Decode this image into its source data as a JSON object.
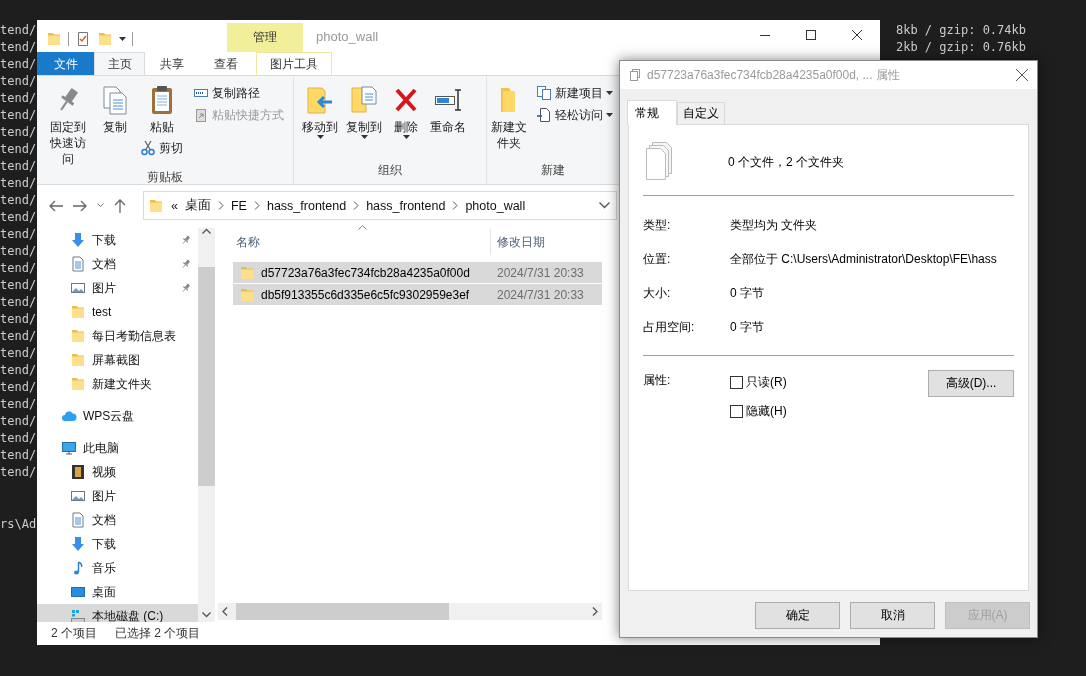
{
  "terminal": {
    "left_lines": [
      "tend/",
      "tend/",
      "tend/",
      "tend/",
      "tend/",
      "tend/",
      "tend/",
      "tend/",
      "tend/",
      "tend/",
      "tend/",
      "tend/",
      "tend/",
      "tend/",
      "tend/",
      "tend/",
      "tend/",
      "tend/",
      "tend/",
      "tend/",
      "tend/",
      "tend/",
      "tend/",
      "tend/",
      "tend/",
      "tend/",
      "tend/"
    ],
    "prompt_fragment": "rs\\Ad",
    "right_lines": [
      "8kb / gzip: 0.74kb",
      "2kb / gzip: 0.76kb"
    ]
  },
  "explorer": {
    "title": "photo_wall",
    "context_group": "管理",
    "ribbon_tabs": [
      {
        "label": "文件",
        "kind": "file",
        "selected": false
      },
      {
        "label": "主页",
        "kind": "normal",
        "selected": true
      },
      {
        "label": "共享",
        "kind": "normal",
        "selected": false
      },
      {
        "label": "查看",
        "kind": "normal",
        "selected": false
      },
      {
        "label": "图片工具",
        "kind": "contextual",
        "selected": false
      }
    ],
    "ribbon_groups": [
      {
        "label": "剪贴板",
        "columns": [
          [
            {
              "label": "固定到快速访问",
              "kind": "large",
              "disabled": false,
              "dropdown": false
            }
          ],
          [
            {
              "label": "复制",
              "kind": "large",
              "disabled": false,
              "dropdown": false
            }
          ],
          [
            {
              "label": "粘贴",
              "kind": "large",
              "disabled": false,
              "dropdown": false
            },
            {
              "label": "剪切",
              "kind": "small",
              "disabled": false,
              "dropdown": false
            }
          ],
          [
            {
              "label": "复制路径",
              "kind": "small",
              "disabled": false,
              "dropdown": false
            },
            {
              "label": "粘贴快捷方式",
              "kind": "small",
              "disabled": true,
              "dropdown": false
            }
          ]
        ]
      },
      {
        "label": "组织",
        "columns": [
          [
            {
              "label": "移动到",
              "kind": "large",
              "disabled": false,
              "dropdown": true
            }
          ],
          [
            {
              "label": "复制到",
              "kind": "large",
              "disabled": false,
              "dropdown": true
            }
          ],
          [
            {
              "label": "删除",
              "kind": "large",
              "disabled": false,
              "dropdown": true
            }
          ],
          [
            {
              "label": "重命名",
              "kind": "large",
              "disabled": false,
              "dropdown": false
            }
          ]
        ]
      },
      {
        "label": "新建",
        "columns": [
          [
            {
              "label": "新建文件夹",
              "kind": "large",
              "disabled": false,
              "dropdown": false
            }
          ],
          [
            {
              "label": "新建项目",
              "kind": "small",
              "disabled": false,
              "dropdown": true
            },
            {
              "label": "轻松访问",
              "kind": "small",
              "disabled": false,
              "dropdown": true
            }
          ]
        ]
      }
    ],
    "address": {
      "overflow_marker": "«",
      "path": [
        "桌面",
        "FE",
        "hass_frontend",
        "hass_frontend",
        "photo_wall"
      ]
    },
    "nav_pane": {
      "quick_access": [
        {
          "label": "下载",
          "pinned": true,
          "selected": false
        },
        {
          "label": "文档",
          "pinned": true,
          "selected": false
        },
        {
          "label": "图片",
          "pinned": true,
          "selected": false
        },
        {
          "label": "test",
          "pinned": false,
          "selected": false
        },
        {
          "label": "每日考勤信息表",
          "pinned": false,
          "selected": false
        },
        {
          "label": "屏幕截图",
          "pinned": false,
          "selected": false
        },
        {
          "label": "新建文件夹",
          "pinned": false,
          "selected": false
        }
      ],
      "locations": [
        {
          "label": "WPS云盘",
          "selected": false
        },
        {
          "label": "此电脑",
          "selected": false,
          "children": [
            {
              "label": "视频",
              "selected": false
            },
            {
              "label": "图片",
              "selected": false
            },
            {
              "label": "文档",
              "selected": false
            },
            {
              "label": "下载",
              "selected": false
            },
            {
              "label": "音乐",
              "selected": false
            },
            {
              "label": "桌面",
              "selected": false
            },
            {
              "label": "本地磁盘 (C:)",
              "selected": true
            }
          ]
        }
      ]
    },
    "file_list": {
      "columns": [
        "名称",
        "修改日期"
      ],
      "rows": [
        {
          "name": "d57723a76a3fec734fcb28a4235a0f00d",
          "modified": "2024/7/31 20:33",
          "selected": true
        },
        {
          "name": "db5f913355c6d335e6c5fc9302959e3ef",
          "modified": "2024/7/31 20:33",
          "selected": true
        }
      ]
    },
    "status_bar": {
      "item_count": "2 个项目",
      "selection": "已选择 2 个项目"
    }
  },
  "dialog": {
    "title": "d57723a76a3fec734fcb28a4235a0f00d, ... 属性",
    "tabs": [
      {
        "label": "常规",
        "selected": true
      },
      {
        "label": "自定义",
        "selected": false
      }
    ],
    "summary": "0 个文件，2 个文件夹",
    "fields": [
      {
        "label": "类型:",
        "value": "类型均为 文件夹"
      },
      {
        "label": "位置:",
        "value": "全部位于 C:\\Users\\Administrator\\Desktop\\FE\\hass"
      },
      {
        "label": "大小:",
        "value": "0 字节"
      },
      {
        "label": "占用空间:",
        "value": "0 字节"
      }
    ],
    "attributes_label": "属性:",
    "checkboxes": [
      {
        "label": "只读(R)",
        "checked": false
      },
      {
        "label": "隐藏(H)",
        "checked": false
      }
    ],
    "advanced_button": "高级(D)...",
    "buttons": [
      {
        "label": "确定",
        "disabled": false
      },
      {
        "label": "取消",
        "disabled": false
      },
      {
        "label": "应用(A)",
        "disabled": true
      }
    ]
  }
}
